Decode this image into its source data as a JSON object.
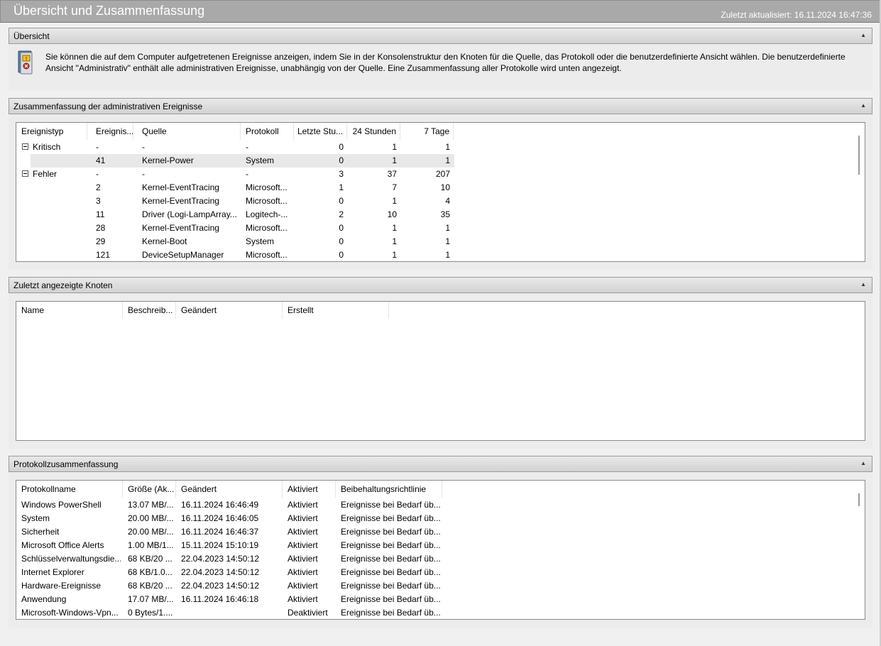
{
  "window": {
    "title": "Übersicht und Zusammenfassung",
    "updated": "Zuletzt aktualisiert: 16.11.2024 16:47:36"
  },
  "overview": {
    "heading": "Übersicht",
    "text": "Sie können die auf dem Computer aufgetretenen Ereignisse anzeigen, indem Sie in der Konsolenstruktur den Knoten für die Quelle, das Protokoll oder die benutzerdefinierte Ansicht wählen. Die benutzerdefinierte Ansicht \"Administrativ\" enthält alle administrativen Ereignisse, unabhängig von der Quelle. Eine Zusammenfassung aller Protokolle wird unten angezeigt.",
    "icon": "event-log-icon"
  },
  "admin_summary": {
    "heading": "Zusammenfassung der administrativen Ereignisse",
    "columns": [
      "Ereignistyp",
      "Ereignis...",
      "Quelle",
      "Protokoll",
      "Letzte Stu...",
      "24 Stunden",
      "7 Tage"
    ],
    "groups": [
      {
        "type": "Kritisch",
        "id": "-",
        "source": "-",
        "log": "-",
        "hour": "0",
        "day": "1",
        "week": "1",
        "rows": [
          {
            "id": "41",
            "source": "Kernel-Power",
            "log": "System",
            "hour": "0",
            "day": "1",
            "week": "1"
          }
        ]
      },
      {
        "type": "Fehler",
        "id": "-",
        "source": "-",
        "log": "-",
        "hour": "3",
        "day": "37",
        "week": "207",
        "rows": [
          {
            "id": "2",
            "source": "Kernel-EventTracing",
            "log": "Microsoft...",
            "hour": "1",
            "day": "7",
            "week": "10"
          },
          {
            "id": "3",
            "source": "Kernel-EventTracing",
            "log": "Microsoft...",
            "hour": "0",
            "day": "1",
            "week": "4"
          },
          {
            "id": "11",
            "source": "Driver (Logi-LampArray...",
            "log": "Logitech-...",
            "hour": "2",
            "day": "10",
            "week": "35"
          },
          {
            "id": "28",
            "source": "Kernel-EventTracing",
            "log": "Microsoft...",
            "hour": "0",
            "day": "1",
            "week": "1"
          },
          {
            "id": "29",
            "source": "Kernel-Boot",
            "log": "System",
            "hour": "0",
            "day": "1",
            "week": "1"
          },
          {
            "id": "121",
            "source": "DeviceSetupManager",
            "log": "Microsoft...",
            "hour": "0",
            "day": "1",
            "week": "1"
          }
        ]
      }
    ]
  },
  "recent_nodes": {
    "heading": "Zuletzt angezeigte Knoten",
    "columns": [
      "Name",
      "Beschreib...",
      "Geändert",
      "Erstellt"
    ]
  },
  "log_summary": {
    "heading": "Protokollzusammenfassung",
    "columns": [
      "Protokollname",
      "Größe (Ak...",
      "Geändert",
      "Aktiviert",
      "Beibehaltungsrichtlinie"
    ],
    "rows": [
      [
        "Windows PowerShell",
        "13.07 MB/...",
        "16.11.2024 16:46:49",
        "Aktiviert",
        "Ereignisse bei Bedarf üb..."
      ],
      [
        "System",
        "20.00 MB/...",
        "16.11.2024 16:46:05",
        "Aktiviert",
        "Ereignisse bei Bedarf üb..."
      ],
      [
        "Sicherheit",
        "20.00 MB/...",
        "16.11.2024 16:46:37",
        "Aktiviert",
        "Ereignisse bei Bedarf üb..."
      ],
      [
        "Microsoft Office Alerts",
        "1.00 MB/1...",
        "15.11.2024 15:10:19",
        "Aktiviert",
        "Ereignisse bei Bedarf üb..."
      ],
      [
        "Schlüsselverwaltungsdie...",
        "68 KB/20 ...",
        "22.04.2023 14:50:12",
        "Aktiviert",
        "Ereignisse bei Bedarf üb..."
      ],
      [
        "Internet Explorer",
        "68 KB/1.0...",
        "22.04.2023 14:50:12",
        "Aktiviert",
        "Ereignisse bei Bedarf üb..."
      ],
      [
        "Hardware-Ereignisse",
        "68 KB/20 ...",
        "22.04.2023 14:50:12",
        "Aktiviert",
        "Ereignisse bei Bedarf üb..."
      ],
      [
        "Anwendung",
        "17.07 MB/...",
        "16.11.2024 16:46:18",
        "Aktiviert",
        "Ereignisse bei Bedarf üb..."
      ],
      [
        "Microsoft-Windows-Vpn...",
        "0 Bytes/1....",
        "",
        "Deaktiviert",
        "Ereignisse bei Bedarf üb..."
      ]
    ]
  }
}
